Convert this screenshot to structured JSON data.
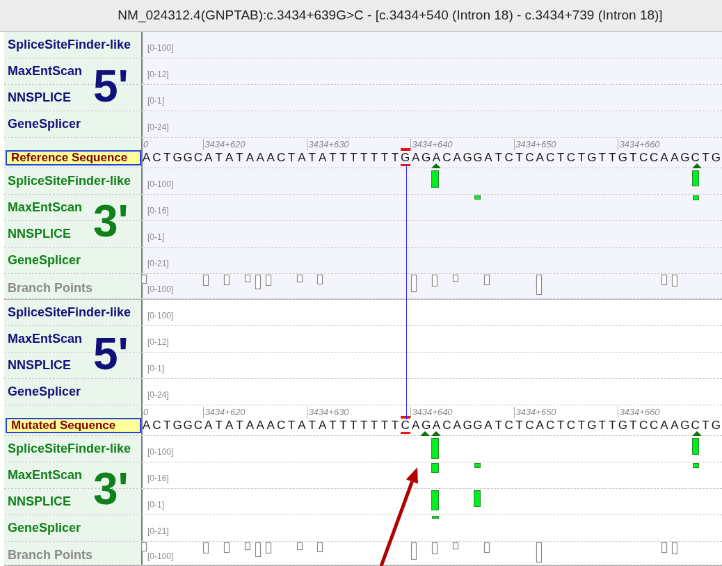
{
  "title": "NM_024312.4(GNPTAB):c.3434+639G>C - [c.3434+540 (Intron 18) - c.3434+739 (Intron 18)]",
  "panels": [
    {
      "kind": "reference",
      "five_prime": {
        "label": "5'",
        "tracks": [
          {
            "name": "SpliceSiteFinder-like",
            "range": "[0-100]"
          },
          {
            "name": "MaxEntScan",
            "range": "[0-12]"
          },
          {
            "name": "NNSPLICE",
            "range": "[0-1]"
          },
          {
            "name": "GeneSplicer",
            "range": "[0-24]"
          }
        ]
      },
      "ruler": [
        "0",
        "3434+620",
        "3434+630",
        "3434+640",
        "3434+650",
        "3434+660"
      ],
      "sequence": {
        "label": "Reference Sequence",
        "bases": "ACTGGCATATAAACTATATTTTTTTGAGACAGGATCTCACTCTGTTGTCCAAGCTG"
      },
      "three_prime": {
        "label": "3'",
        "tracks": [
          {
            "kind": "score",
            "name": "SpliceSiteFinder-like",
            "range": "[0-100]"
          },
          {
            "kind": "score",
            "name": "MaxEntScan",
            "range": "[0-16]"
          },
          {
            "kind": "score",
            "name": "NNSPLICE",
            "range": "[0-1]"
          },
          {
            "kind": "score",
            "name": "GeneSplicer",
            "range": "[0-21]"
          },
          {
            "kind": "branch",
            "name": "Branch Points",
            "range": "[0-100]"
          }
        ]
      }
    },
    {
      "kind": "mutated",
      "five_prime": {
        "label": "5'",
        "tracks": [
          {
            "name": "SpliceSiteFinder-like",
            "range": "[0-100]"
          },
          {
            "name": "MaxEntScan",
            "range": "[0-12]"
          },
          {
            "name": "NNSPLICE",
            "range": "[0-1]"
          },
          {
            "name": "GeneSplicer",
            "range": "[0-24]"
          }
        ]
      },
      "ruler": [
        "0",
        "3434+620",
        "3434+630",
        "3434+640",
        "3434+650",
        "3434+660"
      ],
      "sequence": {
        "label": "Mutated Sequence",
        "bases": "ACTGGCATATAAACTATATTTTTTTCAGACAGGATCTCACTCTGTTGTCCAAGCTG"
      },
      "three_prime": {
        "label": "3'",
        "tracks": [
          {
            "kind": "score",
            "name": "SpliceSiteFinder-like",
            "range": "[0-100]"
          },
          {
            "kind": "score",
            "name": "MaxEntScan",
            "range": "[0-16]"
          },
          {
            "kind": "score",
            "name": "NNSPLICE",
            "range": "[0-1]"
          },
          {
            "kind": "score",
            "name": "GeneSplicer",
            "range": "[0-21]"
          },
          {
            "kind": "branch",
            "name": "Branch Points",
            "range": "[0-100]"
          }
        ]
      }
    }
  ]
}
